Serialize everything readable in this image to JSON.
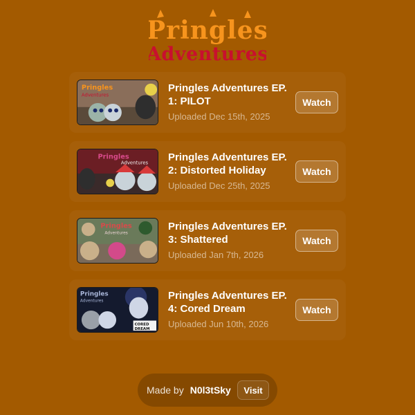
{
  "logo": {
    "line1": "Pringles",
    "line2": "Adventures",
    "line1_color": "#f7941d",
    "line2_color": "#c8102e"
  },
  "episodes": [
    {
      "title": "Pringles Adventures EP. 1: PILOT",
      "date": "Uploaded Dec 15th, 2025",
      "watch_label": "Watch",
      "thumb_text": "Pringles Adventures",
      "thumb_colors": [
        "#9bb3a8",
        "#5a4a3a",
        "#c9d3d9"
      ]
    },
    {
      "title": "Pringles Adventures EP. 2: Distorted Holiday",
      "date": "Uploaded Dec 25th, 2025",
      "watch_label": "Watch",
      "thumb_text": "Pringles Adventures",
      "thumb_colors": [
        "#6b1e24",
        "#2e5a2e",
        "#d83a3a"
      ]
    },
    {
      "title": "Pringles Adventures EP. 3: Shattered",
      "date": "Uploaded Jan 7th, 2026",
      "watch_label": "Watch",
      "thumb_text": "Pringles Adventures",
      "thumb_colors": [
        "#6a7a5a",
        "#c9b08a",
        "#d34a8a"
      ]
    },
    {
      "title": "Pringles Adventures EP. 4: Cored Dream",
      "date": "Uploaded Jun 10th, 2026",
      "watch_label": "Watch",
      "thumb_text": "Pringles Adventures",
      "caption_text": "CORED DREAM",
      "thumb_colors": [
        "#141a2e",
        "#2a3566",
        "#cfd6e6"
      ]
    }
  ],
  "footer": {
    "made_by": "Made by",
    "author": "N0l3tSky",
    "visit_label": "Visit"
  }
}
